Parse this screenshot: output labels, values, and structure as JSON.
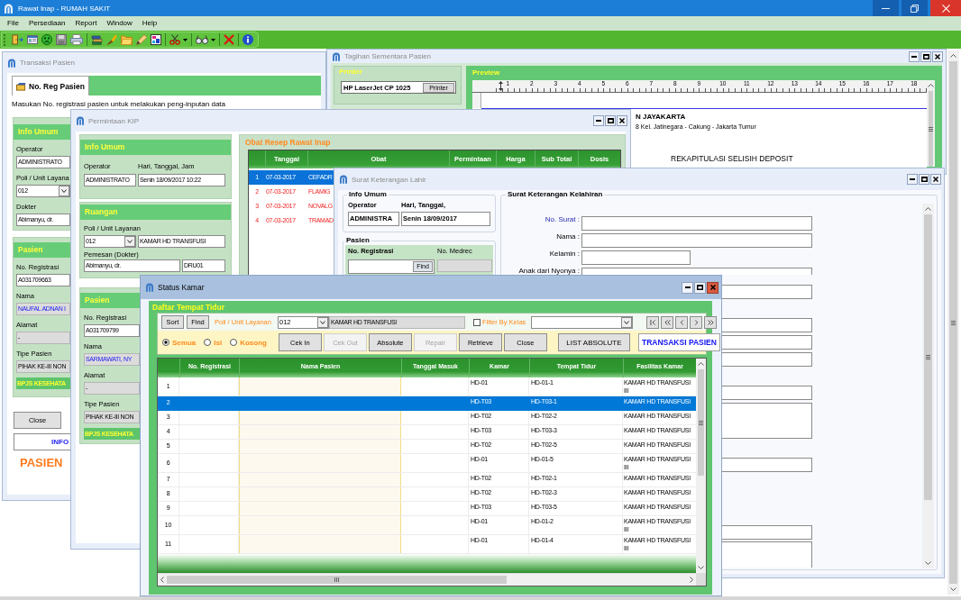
{
  "app": {
    "title": "Rawat Inap - RUMAH SAKIT",
    "menu": [
      "File",
      "Persediaan",
      "Report",
      "Window",
      "Help"
    ]
  },
  "transaksi_pasien": {
    "title": "Transaksi Pasien",
    "active": false,
    "tabs": [
      {
        "label": "No. Reg Pasien",
        "selected": true
      }
    ],
    "instruction": "Masukan No. registrasi pasien untuk melakukan peng-inputan data",
    "panels": [
      {
        "title": "Info Umum",
        "fields": [
          {
            "label": "Operator",
            "value": "ADMINISTRATO",
            "kind": "input"
          },
          {
            "label": "Poli / Unit Layana",
            "value": "012",
            "kind": "combo"
          },
          {
            "label": "Dokter",
            "value": "Abimanyu, dr.",
            "kind": "input"
          }
        ]
      },
      {
        "title": "Pasien",
        "fields": [
          {
            "label": "No. Registrasi",
            "value": "A031709663",
            "kind": "input"
          },
          {
            "label": "Nama",
            "value": "NAUFAL ADNAN I",
            "kind": "highlight"
          },
          {
            "label": "Alamat",
            "value": "-",
            "kind": "readonly"
          },
          {
            "label": "Tipe Pasien",
            "value": "PIHAK KE-III NON",
            "kind": "readonly"
          }
        ],
        "payer": "BPJS KESEHATA"
      }
    ],
    "close_button": "Close",
    "info_banner": "INFO",
    "status": "PASIEN"
  },
  "tagihan_sementara": {
    "title": "Tagihan Sementara Pasien",
    "active": false,
    "printer": {
      "title": "Printer",
      "name": "HP LaserJet CP 1025",
      "button": "Printer"
    },
    "preview": {
      "title": "Preview",
      "ruler": [
        "1",
        "2",
        "3",
        "4",
        "5",
        "6",
        "7",
        "8",
        "9",
        "10",
        "11",
        "12",
        "13",
        "14",
        "15",
        "16",
        "17",
        "18"
      ],
      "lines": [
        {
          "kind": "heading",
          "text": "N JAYAKARTA"
        },
        {
          "kind": "address",
          "text": "8 Kel. Jatinegara - Cakung - Jakarta Tumur"
        },
        {
          "kind": "title",
          "text": "REKAPITULASI SELISIH DEPOSIT"
        }
      ]
    }
  },
  "permintaan_kip": {
    "title": "Permintaan KIP",
    "active": false,
    "info_umum": {
      "title": "Info Umum",
      "fields": [
        {
          "label": "Operator",
          "value": "ADMINISTRATO"
        },
        {
          "label": "Hari, Tanggal, Jam",
          "value": "Senin 18/09/2017 10:22"
        }
      ]
    },
    "ruangan": {
      "title": "Ruangan",
      "poli_label": "Poli / Unit Layanan",
      "poli_code": "012",
      "poli_name": "KAMAR HD TRANSFUSI",
      "dokter_label": "Pemesan (Dokter)",
      "dokter_name": "Abimanyu, dr.",
      "dokter_code": "DRU01"
    },
    "pasien": {
      "title": "Pasien",
      "fields": [
        {
          "label": "No. Registrasi",
          "value": "A031709799",
          "kind": "input"
        },
        {
          "label": "Nama",
          "value": "SARMAWATI, NY",
          "kind": "highlight"
        },
        {
          "label": "Alamat",
          "value": "-",
          "kind": "readonly"
        },
        {
          "label": "Tipe Pasien",
          "value": "PIHAK KE-III NON",
          "kind": "readonly"
        }
      ],
      "payer": "BPJS KESEHATA"
    },
    "resep": {
      "title": "Obat Resep Rawat Inap",
      "columns": [
        "Tanggal",
        "Obat",
        "Permintaan",
        "Harga",
        "Sub Total",
        "Dosis"
      ],
      "rows": [
        {
          "number": "1",
          "tanggal": "07-03-2017",
          "obat": "CEFADR",
          "selected": true
        },
        {
          "number": "2",
          "tanggal": "07-03-2017",
          "obat": "FLAMIG",
          "selected": false
        },
        {
          "number": "3",
          "tanggal": "07-03-2017",
          "obat": "NOVALG",
          "selected": false
        },
        {
          "number": "4",
          "tanggal": "07-03-2017",
          "obat": "TRAMAD",
          "selected": false
        }
      ]
    }
  },
  "surat_keterangan_lahir": {
    "title": "Surat Keterangan Lahir",
    "active": false,
    "info_umum": {
      "title": "Info Umum",
      "fields": [
        {
          "label": "Operator",
          "value": "ADMINISTRA"
        },
        {
          "label": "Hari, Tanggal,",
          "value": "Senin 18/09/2017"
        }
      ]
    },
    "pasien": {
      "title": "Pasien",
      "registrasi_label": "No. Registrasi",
      "medrec_label": "No. Medrec",
      "find_button": "Find"
    },
    "form": {
      "title": "Surat Keterangan Kelahiran",
      "fields": [
        {
          "label": "No. Surat :",
          "kind": "long",
          "highlighted": true
        },
        {
          "label": "Nama :",
          "kind": "long",
          "highlighted": false
        },
        {
          "label": "Kelamin :",
          "kind": "short",
          "highlighted": false
        },
        {
          "label": "Anak dari Nyonya :",
          "kind": "long",
          "highlighted": false
        },
        {
          "kind": "long"
        },
        {
          "kind": "long"
        },
        {
          "kind": "long"
        },
        {
          "kind": "long"
        },
        {
          "kind": "long"
        },
        {
          "kind": "memo"
        },
        {
          "kind": "long"
        },
        {
          "kind": "long"
        },
        {
          "kind": "memo"
        }
      ]
    }
  },
  "status_kamar": {
    "title": "Status Kamar",
    "active": true,
    "group_title": "Daftar Tempat Tidur",
    "sort_button": "Sort",
    "find_button": "Find",
    "poli_label": "Poli / Unit Layanan",
    "poli_code": "012",
    "poli_name": "KAMAR HD TRANSFUSI",
    "filter": {
      "label": "Filter By Kelas",
      "checked": false
    },
    "radios": [
      {
        "label": "Semua",
        "selected": true
      },
      {
        "label": "Isi",
        "selected": false
      },
      {
        "label": "Kosong",
        "selected": false
      }
    ],
    "actions": [
      {
        "label": "Cek In",
        "disabled": false
      },
      {
        "label": "Cek Out",
        "disabled": true
      },
      {
        "label": "Absolute",
        "disabled": false
      },
      {
        "label": "Repair",
        "disabled": true
      },
      {
        "label": "Retrieve",
        "disabled": false
      },
      {
        "label": "Close",
        "disabled": false
      }
    ],
    "list_button": "LIST ABSOLUTE",
    "transaksi_button": "TRANSAKSI PASIEN",
    "table": {
      "columns": [
        "No. Registrasi",
        "Nama Pasien",
        "Tanggal Masuk",
        "Kamar",
        "Tempat Tidur",
        "Fasilitas Kamar"
      ],
      "rows": [
        {
          "number": "1",
          "kamar": "HD-01",
          "tempat_tidur": "HD-01-1",
          "fasilitas": "KAMAR HD TRANSFUSI III",
          "selected": false
        },
        {
          "number": "2",
          "kamar": "HD-T03",
          "tempat_tidur": "HD-T03-1",
          "fasilitas": "KAMAR HD TRANSFUSI",
          "selected": true
        },
        {
          "number": "3",
          "kamar": "HD-T02",
          "tempat_tidur": "HD-T02-2",
          "fasilitas": "KAMAR HD TRANSFUSI",
          "selected": false
        },
        {
          "number": "4",
          "kamar": "HD-T03",
          "tempat_tidur": "HD-T03-3",
          "fasilitas": "KAMAR HD TRANSFUSI",
          "selected": false
        },
        {
          "number": "5",
          "kamar": "HD-T02",
          "tempat_tidur": "HD-T02-5",
          "fasilitas": "KAMAR HD TRANSFUSI",
          "selected": false
        },
        {
          "number": "6",
          "kamar": "HD-01",
          "tempat_tidur": "HD-01-5",
          "fasilitas": "KAMAR HD TRANSFUSI III",
          "selected": false
        },
        {
          "number": "7",
          "kamar": "HD-T02",
          "tempat_tidur": "HD-T02-1",
          "fasilitas": "KAMAR HD TRANSFUSI",
          "selected": false
        },
        {
          "number": "8",
          "kamar": "HD-T02",
          "tempat_tidur": "HD-T02-3",
          "fasilitas": "KAMAR HD TRANSFUSI",
          "selected": false
        },
        {
          "number": "9",
          "kamar": "HD-T03",
          "tempat_tidur": "HD-T03-5",
          "fasilitas": "KAMAR HD TRANSFUSI",
          "selected": false
        },
        {
          "number": "10",
          "kamar": "HD-01",
          "tempat_tidur": "HD-01-2",
          "fasilitas": "KAMAR HD TRANSFUSI III",
          "selected": false
        },
        {
          "number": "11",
          "kamar": "HD-01",
          "tempat_tidur": "HD-01-4",
          "fasilitas": "KAMAR HD TRANSFUSI III",
          "selected": false
        }
      ]
    }
  }
}
